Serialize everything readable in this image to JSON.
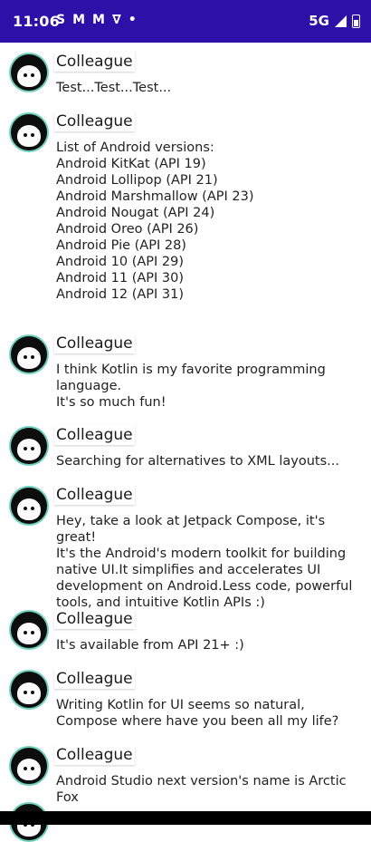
{
  "status_bar": {
    "time": "11:06",
    "icons": [
      "S",
      "M",
      "M",
      "∇",
      "•"
    ],
    "network": "5G"
  },
  "messages": [
    {
      "author": "Colleague",
      "body": "Test...Test...Test..."
    },
    {
      "author": "Colleague",
      "body": "List of Android versions:\nAndroid KitKat (API 19)\nAndroid Lollipop (API 21)\nAndroid Marshmallow (API 23)\nAndroid Nougat (API 24)\nAndroid Oreo (API 26)\nAndroid Pie (API 28)\nAndroid 10 (API 29)\nAndroid 11 (API 30)\nAndroid 12 (API 31)"
    },
    {
      "author": "Colleague",
      "body": "I think Kotlin is my favorite programming language.\nIt's so much fun!"
    },
    {
      "author": "Colleague",
      "body": "Searching for alternatives to XML layouts..."
    },
    {
      "author": "Colleague",
      "body": "Hey, take a look at Jetpack Compose, it's great!\nIt's the Android's modern toolkit for building native UI.It simplifies and accelerates UI development on Android.Less code, powerful tools, and intuitive Kotlin APIs :)"
    },
    {
      "author": "Colleague",
      "body": "It's available from API 21+ :)"
    },
    {
      "author": "Colleague",
      "body": "Writing Kotlin for UI seems so natural, Compose where have you been all my life?"
    },
    {
      "author": "Colleague",
      "body": "Android Studio next version's name is Arctic Fox"
    }
  ]
}
